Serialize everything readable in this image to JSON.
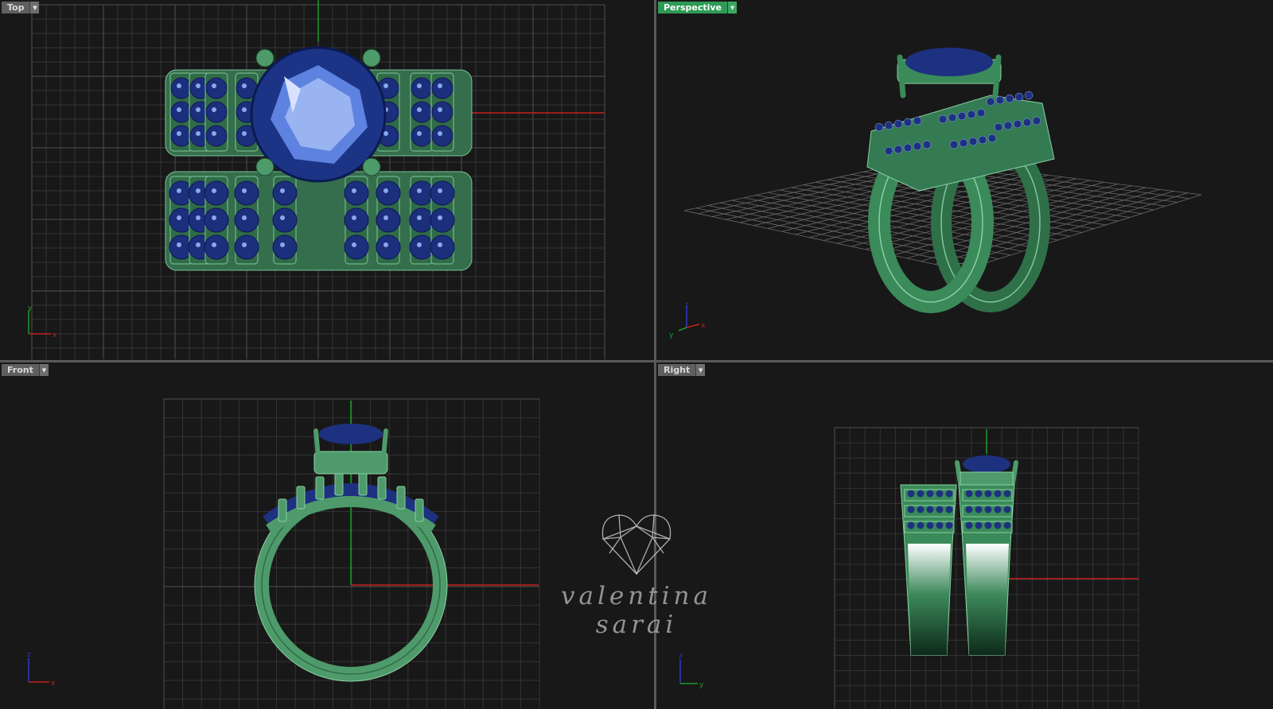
{
  "viewports": {
    "top": {
      "label": "Top",
      "active": false,
      "axes": [
        "y",
        "x"
      ]
    },
    "perspective": {
      "label": "Perspective",
      "active": true,
      "axes": [
        "z",
        "y",
        "x"
      ]
    },
    "front": {
      "label": "Front",
      "active": false,
      "axes": [
        "z",
        "x"
      ]
    },
    "right": {
      "label": "Right",
      "active": false,
      "axes": [
        "z",
        "y"
      ]
    }
  },
  "watermark": {
    "text": "valentina sarai",
    "logo": "heart-gem-icon"
  },
  "colors": {
    "background": "#181818",
    "grid": "#5a5a5a",
    "metal": "#3f8c5c",
    "gem": "#1a2f7a",
    "x_axis": "#c81e1e",
    "y_axis": "#1e9a2e",
    "z_axis": "#2a3cc8",
    "active_tab": "#2e9a55"
  }
}
